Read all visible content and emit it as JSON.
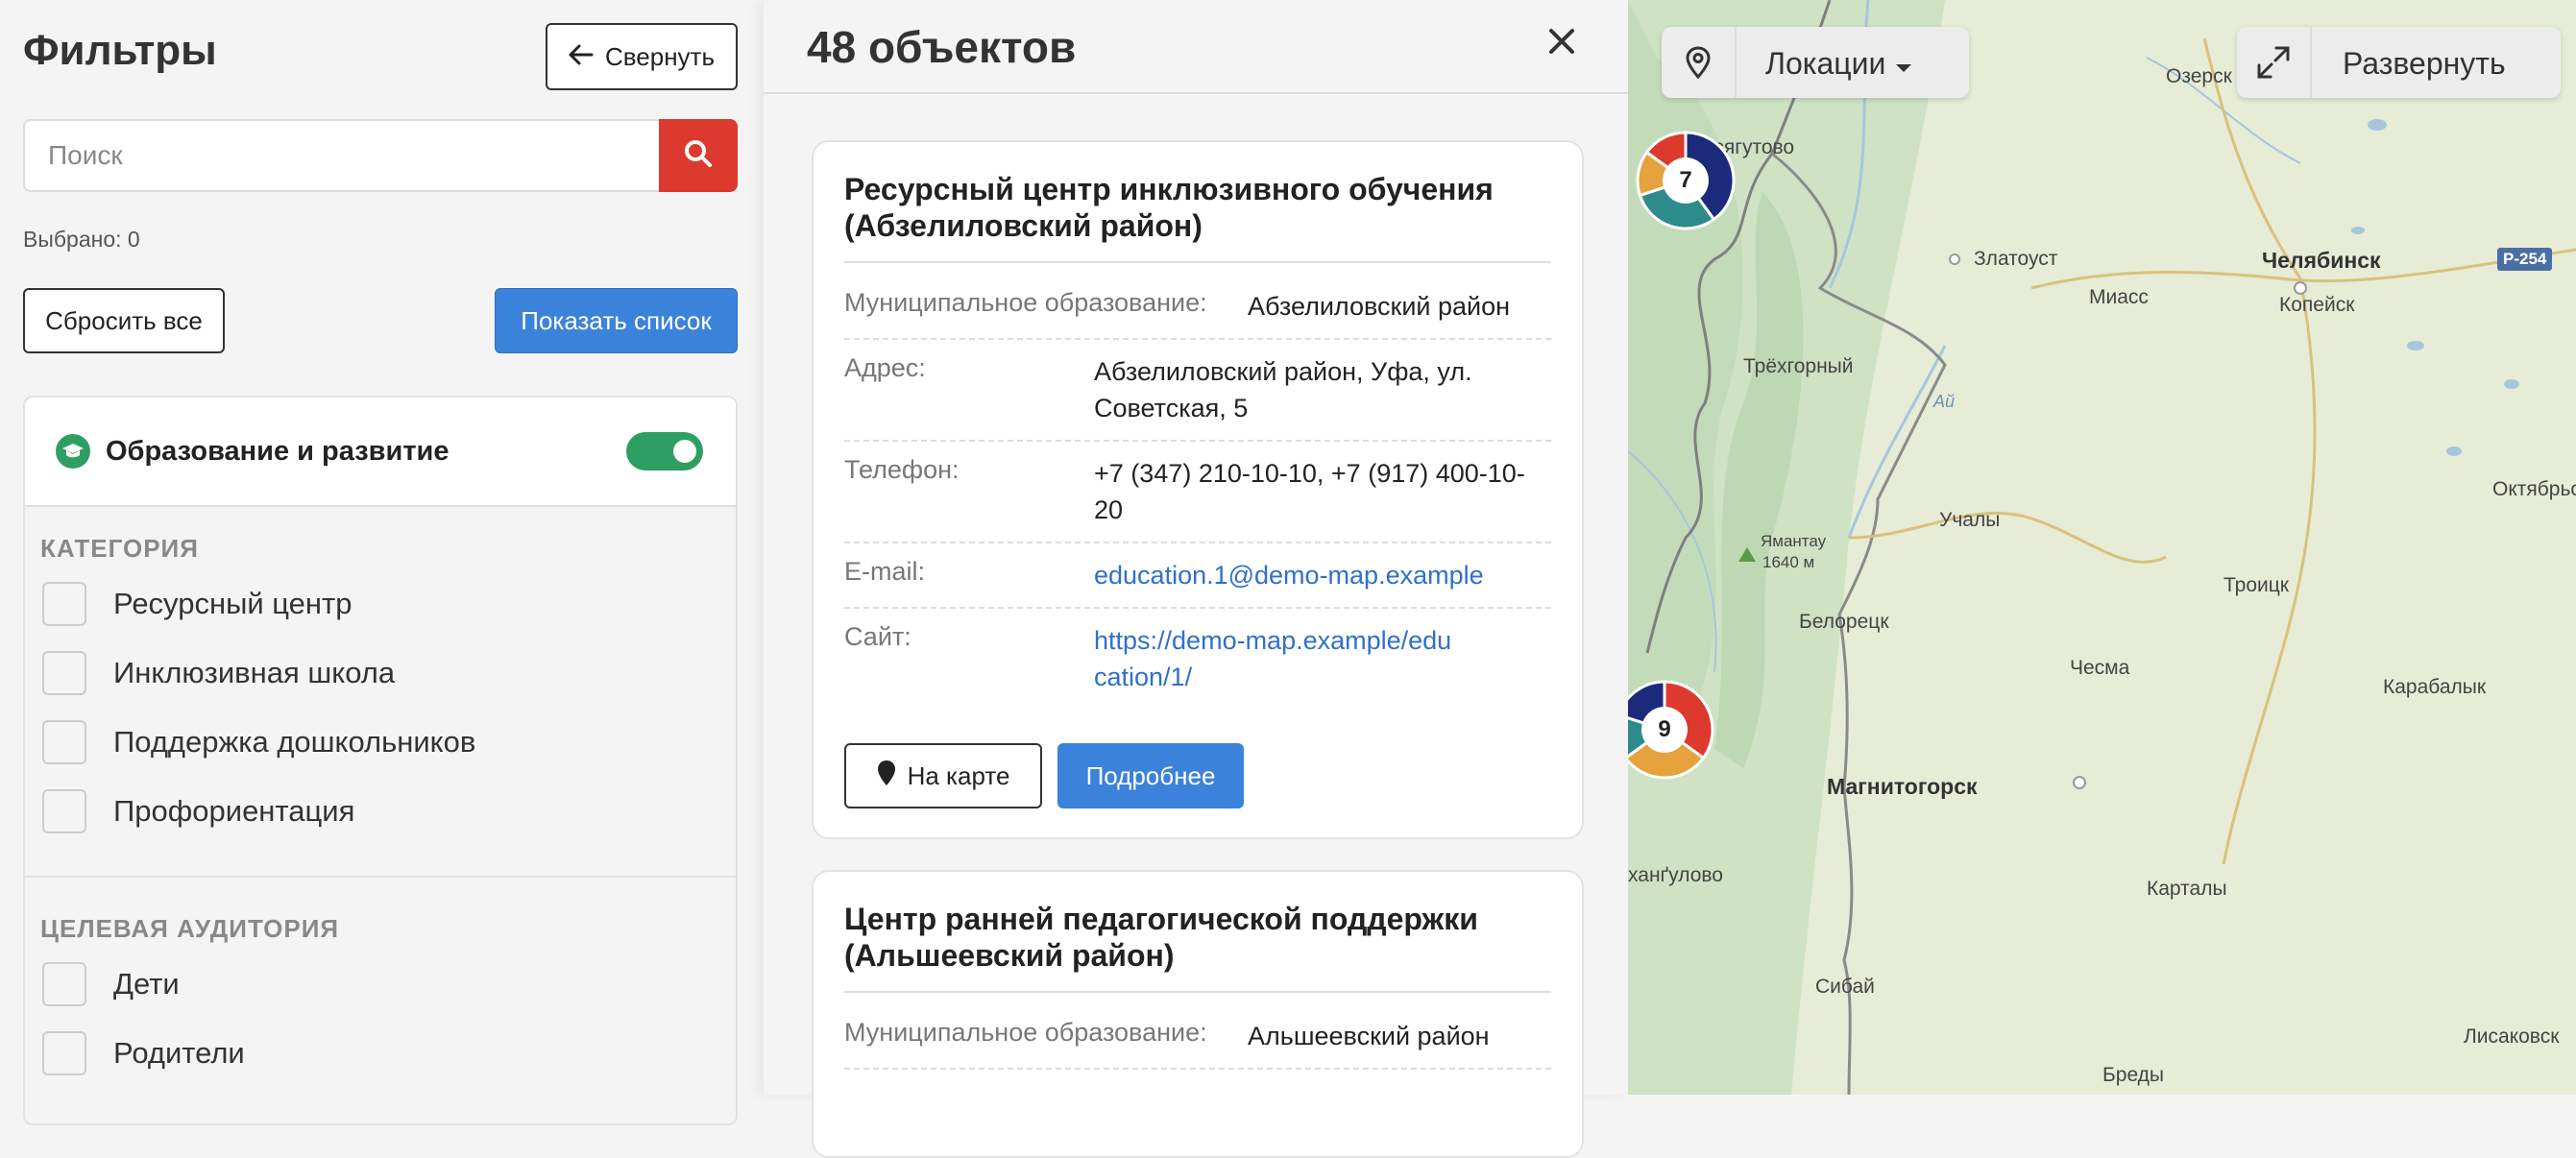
{
  "filters": {
    "title": "Фильтры",
    "collapse_label": "Свернуть",
    "search_placeholder": "Поиск",
    "selected_text": "Выбрано: 0",
    "reset_label": "Сбросить все",
    "show_list_label": "Показать список",
    "group": {
      "title": "Образование и развитие",
      "enabled": true,
      "category_title": "КАТЕГОРИЯ",
      "categories": [
        "Ресурсный центр",
        "Инклюзивная школа",
        "Поддержка дошкольников",
        "Профориентация"
      ],
      "audience_title": "ЦЕЛЕВАЯ АУДИТОРИЯ",
      "audiences": [
        "Дети",
        "Родители"
      ]
    }
  },
  "results": {
    "title": "48 объектов",
    "cards": [
      {
        "title": "Ресурсный центр инклюзивного обучения (Абзелиловский район)",
        "municipality_label": "Муниципальное образование:",
        "municipality": "Абзелиловский район",
        "address_label": "Адрес:",
        "address": "Абзелиловский район, Уфа, ул. Советская, 5",
        "phone_label": "Телефон:",
        "phone": "+7 (347) 210-10-10, +7 (917) 400-10-20",
        "email_label": "E-mail:",
        "email": "education.1@demo-map.example",
        "site_label": "Сайт:",
        "site": "https://demo-map.example/education/1/",
        "on_map_label": "На карте",
        "more_label": "Подробнее"
      },
      {
        "title": "Центр ранней педагогической поддержки (Альшеевский район)",
        "municipality_label": "Муниципальное образование:",
        "municipality": "Альшеевский район"
      }
    ]
  },
  "map": {
    "locations_label": "Локации",
    "expand_label": "Развернуть",
    "road_shield": "Р-254",
    "labels": {
      "mesyagutovo": "Месягутово",
      "ozersk": "Озерск",
      "zlatoust": "Златоуст",
      "chelyabinsk": "Челябинск",
      "kopeysk": "Копейск",
      "miass": "Миасс",
      "tryokhgorny": "Трёхгорный",
      "yamantau": "Ямантау",
      "yamantau_height": "1640 м",
      "uchaly": "Учалы",
      "oktyabrsky": "Октябрьский",
      "beloretsk": "Белорецк",
      "troitsk": "Троицк",
      "chesma": "Чесма",
      "karabalyk": "Карабалык",
      "magnitogorsk": "Магнитогорск",
      "askarovo": "ханґулово",
      "kartaly": "Карталы",
      "sibay": "Сибай",
      "bredy": "Бреды",
      "lisakovsk": "Лисаковск",
      "river_ai": "Ай"
    },
    "clusters": [
      {
        "count": "7",
        "segments": [
          {
            "color": "#1b2a7a",
            "share": 0.4
          },
          {
            "color": "#2e8b8b",
            "share": 0.3
          },
          {
            "color": "#e6a23c",
            "share": 0.15
          },
          {
            "color": "#dc3a2e",
            "share": 0.15
          }
        ]
      },
      {
        "count": "9",
        "segments": [
          {
            "color": "#dc3a2e",
            "share": 0.35
          },
          {
            "color": "#e6a23c",
            "share": 0.3
          },
          {
            "color": "#2e8b8b",
            "share": 0.15
          },
          {
            "color": "#1b2a7a",
            "share": 0.2
          }
        ]
      }
    ]
  },
  "colors": {
    "accent_blue": "#3b82db",
    "search_red": "#dc3a2e",
    "toggle_green": "#2f9e63"
  }
}
